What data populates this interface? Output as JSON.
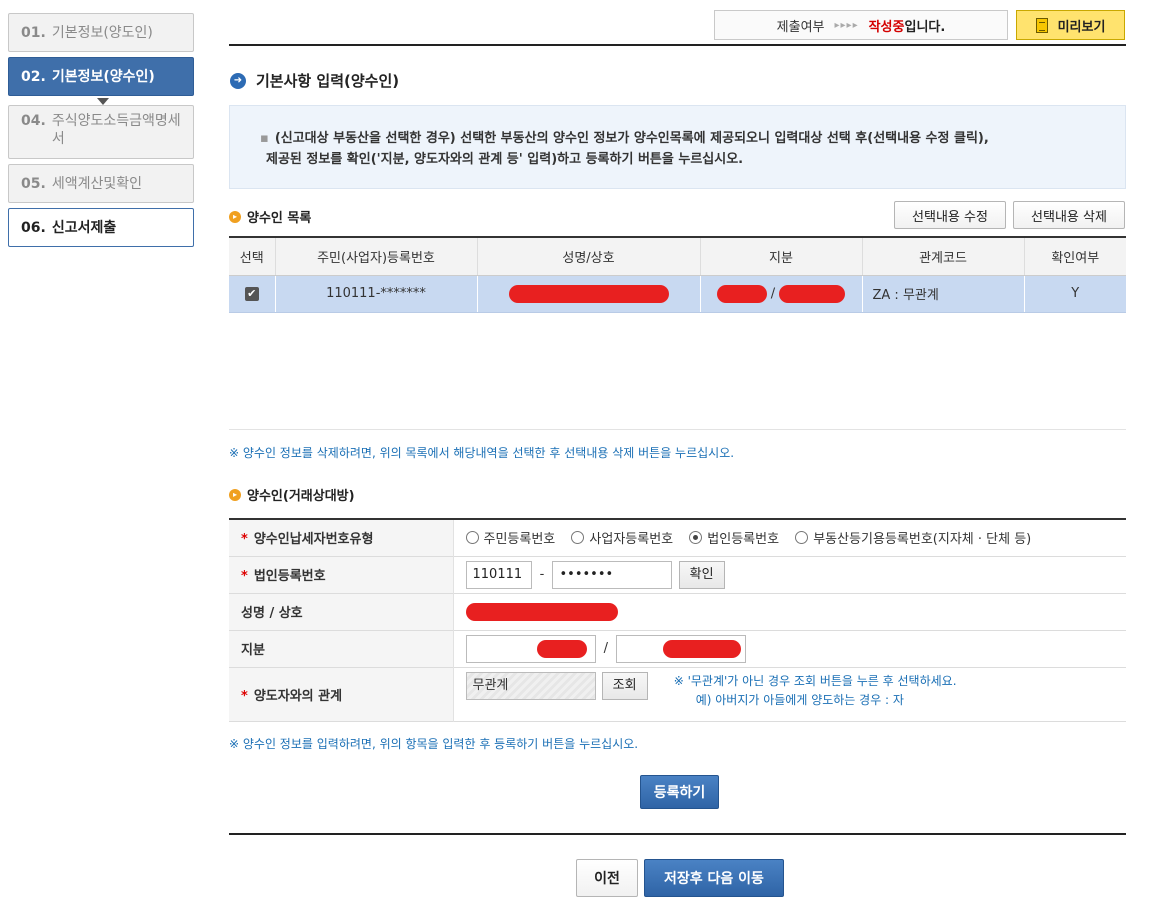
{
  "sidebar": {
    "steps": [
      {
        "num": "01.",
        "label": "기본정보(양도인)"
      },
      {
        "num": "02.",
        "label": "기본정보(양수인)"
      },
      {
        "num": "04.",
        "label": "주식양도소득금액명세서"
      },
      {
        "num": "05.",
        "label": "세액계산및확인"
      },
      {
        "num": "06.",
        "label": "신고서제출"
      }
    ]
  },
  "status": {
    "label": "제출여부",
    "arrows": "▸▸▸▸",
    "state": "작성중",
    "suffix": "입니다.",
    "preview_label": "미리보기"
  },
  "header": {
    "title": "기본사항 입력(양수인)"
  },
  "info": {
    "line1": "(신고대상 부동산을 선택한 경우) 선택한 부동산의 양수인 정보가 양수인목록에 제공되오니 입력대상 선택 후(선택내용 수정 클릭),",
    "line2": "제공된 정보를 확인('지분, 양도자와의 관계 등' 입력)하고 등록하기 버튼을 누르십시오."
  },
  "list": {
    "title": "양수인 목록",
    "edit_button": "선택내용 수정",
    "delete_button": "선택내용 삭제",
    "columns": [
      "선택",
      "주민(사업자)등록번호",
      "성명/상호",
      "지분",
      "관계코드",
      "확인여부"
    ],
    "rows": [
      {
        "checked": "✔",
        "reg_no": "110111-*******",
        "share_sep": "/",
        "relation": "ZA : 무관계",
        "confirmed": "Y"
      }
    ],
    "delete_note": "※ 양수인 정보를 삭제하려면, 위의 목록에서 해당내역을 선택한 후 선택내용 삭제 버튼을 누르십시오."
  },
  "form": {
    "title": "양수인(거래상대방)",
    "type_label": "양수인납세자번호유형",
    "type_options": [
      "주민등록번호",
      "사업자등록번호",
      "법인등록번호",
      "부동산등기용등록번호(지자체 · 단체 등)"
    ],
    "type_selected": "법인등록번호",
    "corp_label": "법인등록번호",
    "corp_part1": "110111",
    "corp_dash": "-",
    "corp_part2": "•••••••",
    "confirm_button": "확인",
    "name_label": "성명 / 상호",
    "share_label": "지분",
    "share_sep": "/",
    "relation_label": "양도자와의 관계",
    "relation_value": "무관계",
    "lookup_button": "조회",
    "relation_note1": "※ '무관계'가 아닌 경우 조회 버튼을 누른 후 선택하세요.",
    "relation_note2": "예) 아버지가 아들에게 양도하는 경우 : 자",
    "input_note": "※ 양수인 정보를 입력하려면, 위의 항목을 입력한 후 등록하기 버튼을 누르십시오.",
    "register_button": "등록하기"
  },
  "footer": {
    "prev_button": "이전",
    "next_button": "저장후 다음 이동"
  },
  "colors": {
    "accent": "#3f6faa",
    "redaction": "#e82020",
    "selected_row": "#c8d9f1"
  }
}
